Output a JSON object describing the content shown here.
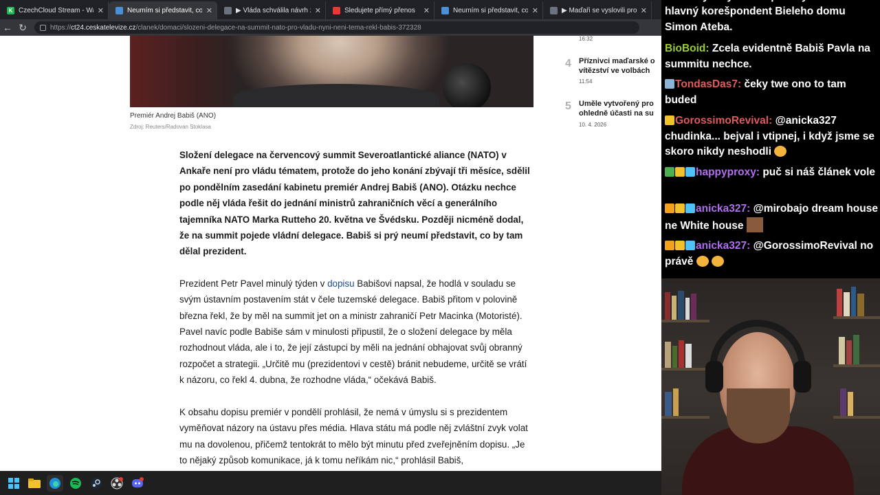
{
  "browser": {
    "tabs": [
      {
        "label": "CzechCloud Stream - Watch Live o",
        "favicon_color": "#1db954",
        "favicon": "K",
        "active": false
      },
      {
        "label": "Neumím si představit, co by na su",
        "favicon_color": "#4a90d9",
        "favicon": "",
        "active": true
      },
      {
        "label": "▶ Vláda schválila návrh zákona, k",
        "favicon_color": "#6b7280",
        "favicon": "",
        "active": false
      },
      {
        "label": "Sledujete přímý přenos",
        "favicon_color": "#e53935",
        "favicon": "",
        "active": false
      },
      {
        "label": "Neumím si představit, co by na su",
        "favicon_color": "#4a90d9",
        "favicon": "",
        "active": false
      },
      {
        "label": "▶ Maďaři se vyslovili pro změnu n",
        "favicon_color": "#6b7280",
        "favicon": "",
        "active": false
      }
    ],
    "url_prefix": "https://",
    "url_domain": "ct24.ceskatelevize.cz",
    "url_path": "/clanek/domaci/slozeni-delegace-na-summit-nato-pro-vladu-nyni-neni-tema-rekl-babis-372328"
  },
  "article": {
    "caption": "Premiér Andrej Babiš (ANO)",
    "source": "Zdroj: Reuters/Radovan Stoklasa",
    "lead": "Složení delegace na červencový summit Severoatlantické aliance (NATO) v Ankaře není pro vládu tématem, protože do jeho konání zbývají tři měsíce, sdělil po pondělním zasedání kabinetu premiér Andrej Babiš (ANO). Otázku nechce podle něj vláda řešit do jednání ministrů zahraničních věcí a generálního tajemníka NATO Marka Rutteho 20. května ve Švédsku. Později nicméně dodal, že na summit pojede vládní delegace. Babiš si prý neumí představit, co by tam dělal prezident.",
    "p1_before": "Prezident Petr Pavel minulý týden v ",
    "p1_link": "dopisu",
    "p1_after": " Babišovi napsal, že hodlá v souladu se svým ústavním postavením stát v čele tuzemské delegace. Babiš přitom v polovině března řekl, že by měl na summit jet on a ministr zahraničí Petr Macinka (Motoristé). Pavel navíc podle Babiše sám v minulosti připustil, že o složení delegace by měla rozhodnout vláda, ale i to, že její zástupci by měli na jednání obhajovat svůj obranný rozpočet a strategii. „Určitě mu (prezidentovi v cestě) bránit nebudeme, určitě se vrátí k názoru, co řekl 4. dubna, že rozhodne vláda,“ očekává Babiš.",
    "p2": "K obsahu dopisu premiér v pondělí prohlásil, že nemá v úmyslu si s prezidentem vyměňovat názory na ústavu přes média. Hlava státu má podle něj zvláštní zvyk volat mu na dovolenou, přičemž tentokrát to mělo být minutu před zveřejněním dopisu. „Je to nějaký způsob komunikace, já k tomu neříkám nic,“ prohlásil Babiš,"
  },
  "sidebar": {
    "top_time": "16:32",
    "items": [
      {
        "num": "4",
        "title": "Příznivci maďarské o\nvítězství ve volbách",
        "time": "11:54"
      },
      {
        "num": "5",
        "title": "Uměle vytvořený pro\nohledně účasti na su",
        "time": "10. 4. 2026"
      }
    ]
  },
  "chat": {
    "messages": [
      {
        "user": "",
        "user_color": "#ffffff",
        "text": "hlavný korešpondent Bieleho domu Simon Ateba.",
        "badges": []
      },
      {
        "user": "BioBoid:",
        "user_color": "#9acd32",
        "text": "Zcela evidentně Babiš Pavla na summitu nechce.",
        "badges": []
      },
      {
        "user": "TondasDas7:",
        "user_color": "#e05a5a",
        "text": "čeky twe ono to tam buded",
        "badges": [
          "#8ab4d8"
        ]
      },
      {
        "user": "GorossimoRevival:",
        "user_color": "#e05a5a",
        "text": "@anicka327 chudinka... bejval i vtipnej, i když jsme se skoro nikdy neshodli",
        "badges": [
          "#f2c12e"
        ]
      },
      {
        "user": "happyproxy:",
        "user_color": "#b06ef0",
        "text": "puč si náš článek vole",
        "badges": [
          "#4caf50",
          "#f2c12e",
          "#4fc3f7"
        ]
      },
      {
        "user": "anicka327:",
        "user_color": "#b06ef0",
        "text": "@mirobajo dream house ne White house",
        "badges": [
          "#f2a01e",
          "#f2c12e",
          "#4fc3f7"
        ]
      },
      {
        "user": "anicka327:",
        "user_color": "#b06ef0",
        "text": "@GorossimoRevival no právě",
        "badges": [
          "#f2a01e",
          "#f2c12e",
          "#4fc3f7"
        ]
      }
    ]
  },
  "taskbar": {
    "icons": [
      "windows-start-icon",
      "file-explorer-icon",
      "edge-browser-icon",
      "spotify-icon",
      "steam-icon",
      "obs-icon",
      "discord-icon"
    ]
  }
}
